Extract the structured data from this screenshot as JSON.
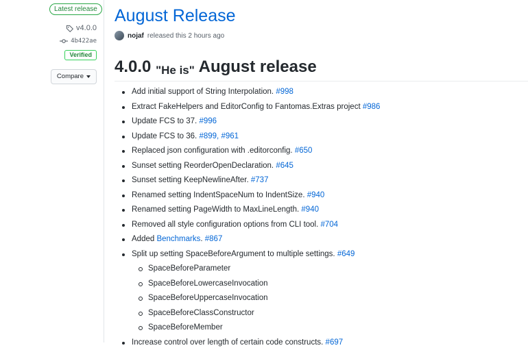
{
  "sidebar": {
    "latest_badge": "Latest release",
    "tag": "v4.0.0",
    "commit": "4b422ae",
    "verified": "Verified",
    "compare": "Compare"
  },
  "release": {
    "title": "August Release",
    "author": "nojaf",
    "meta": "released this 2 hours ago",
    "version": "4.0.0",
    "quote": "\"He is\"",
    "heading_rest": "August release"
  },
  "changes": [
    {
      "text": "Add initial support of String Interpolation. ",
      "links": [
        "#998"
      ]
    },
    {
      "text": "Extract FakeHelpers and EditorConfig to Fantomas.Extras project ",
      "links": [
        "#986"
      ]
    },
    {
      "text": "Update FCS to 37. ",
      "links": [
        "#996"
      ]
    },
    {
      "text": "Update FCS to 36. ",
      "links": [
        "#899",
        "#961"
      ]
    },
    {
      "text": "Replaced json configuration with .editorconfig. ",
      "links": [
        "#650"
      ]
    },
    {
      "text": "Sunset setting ReorderOpenDeclaration. ",
      "links": [
        "#645"
      ]
    },
    {
      "text": "Sunset setting KeepNewlineAfter. ",
      "links": [
        "#737"
      ]
    },
    {
      "text": "Renamed setting IndentSpaceNum to IndentSize. ",
      "links": [
        "#940"
      ]
    },
    {
      "text": "Renamed setting PageWidth to MaxLineLength. ",
      "links": [
        "#940"
      ]
    },
    {
      "text": "Removed all style configuration options from CLI tool. ",
      "links": [
        "#704"
      ]
    },
    {
      "text": "Added ",
      "inline_link": "Benchmarks",
      "after": ". ",
      "links": [
        "#867"
      ]
    },
    {
      "text": "Split up setting SpaceBeforeArgument to multiple settings. ",
      "links": [
        "#649"
      ],
      "sub": [
        "SpaceBeforeParameter",
        "SpaceBeforeLowercaseInvocation",
        "SpaceBeforeUppercaseInvocation",
        "SpaceBeforeClassConstructor",
        "SpaceBeforeMember"
      ]
    },
    {
      "text": "Increase control over length of certain code constructs. ",
      "links": [
        "#697"
      ]
    }
  ]
}
